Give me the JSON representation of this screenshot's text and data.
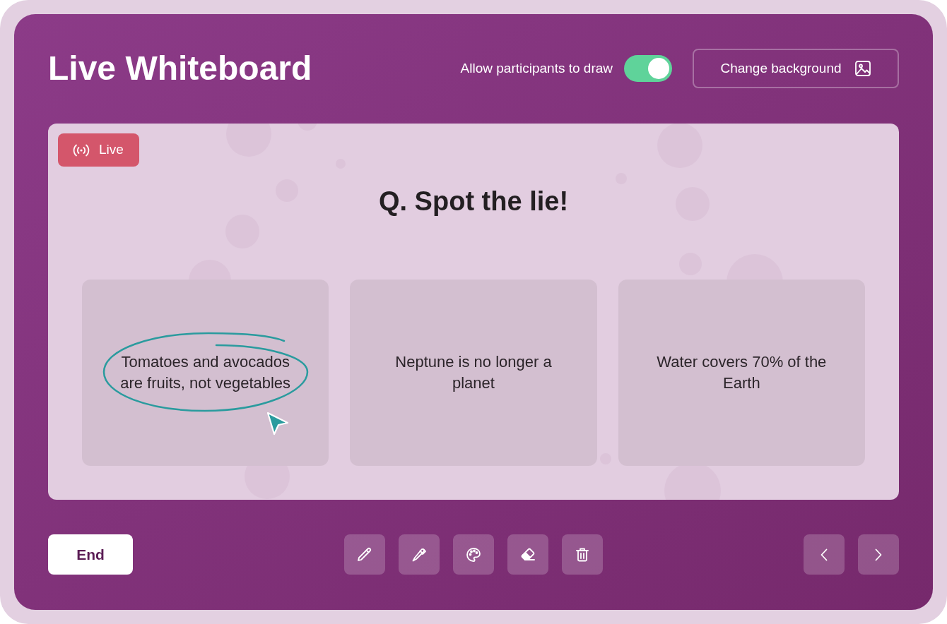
{
  "header": {
    "title": "Live Whiteboard",
    "draw_toggle": {
      "label": "Allow participants to draw",
      "on": true
    },
    "background_button": {
      "label": "Change background"
    }
  },
  "whiteboard": {
    "live_badge": {
      "label": "Live"
    },
    "question": "Q. Spot the lie!",
    "options": [
      {
        "text": "Tomatoes and avocados are fruits, not vegetables",
        "annotated": true
      },
      {
        "text": "Neptune is no longer a planet",
        "annotated": false
      },
      {
        "text": "Water covers 70% of the Earth",
        "annotated": false
      }
    ]
  },
  "footer": {
    "end_button": {
      "label": "End"
    }
  }
}
